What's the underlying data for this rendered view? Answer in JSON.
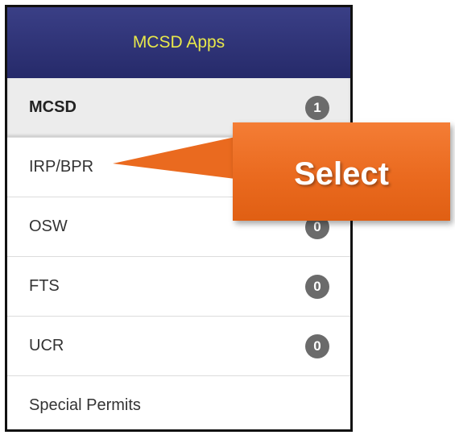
{
  "header": {
    "title": "MCSD Apps"
  },
  "menu": {
    "items": [
      {
        "label": "MCSD",
        "badge": "1"
      },
      {
        "label": "IRP/BPR",
        "badge": ""
      },
      {
        "label": "OSW",
        "badge": "0"
      },
      {
        "label": "FTS",
        "badge": "0"
      },
      {
        "label": "UCR",
        "badge": "0"
      },
      {
        "label": "Special Permits",
        "badge": ""
      }
    ]
  },
  "callout": {
    "text": "Select",
    "color": "#ee6e24"
  },
  "colors": {
    "header_bg": "#2f3478",
    "header_text": "#e8e84a",
    "badge_bg": "#6b6b6b"
  }
}
